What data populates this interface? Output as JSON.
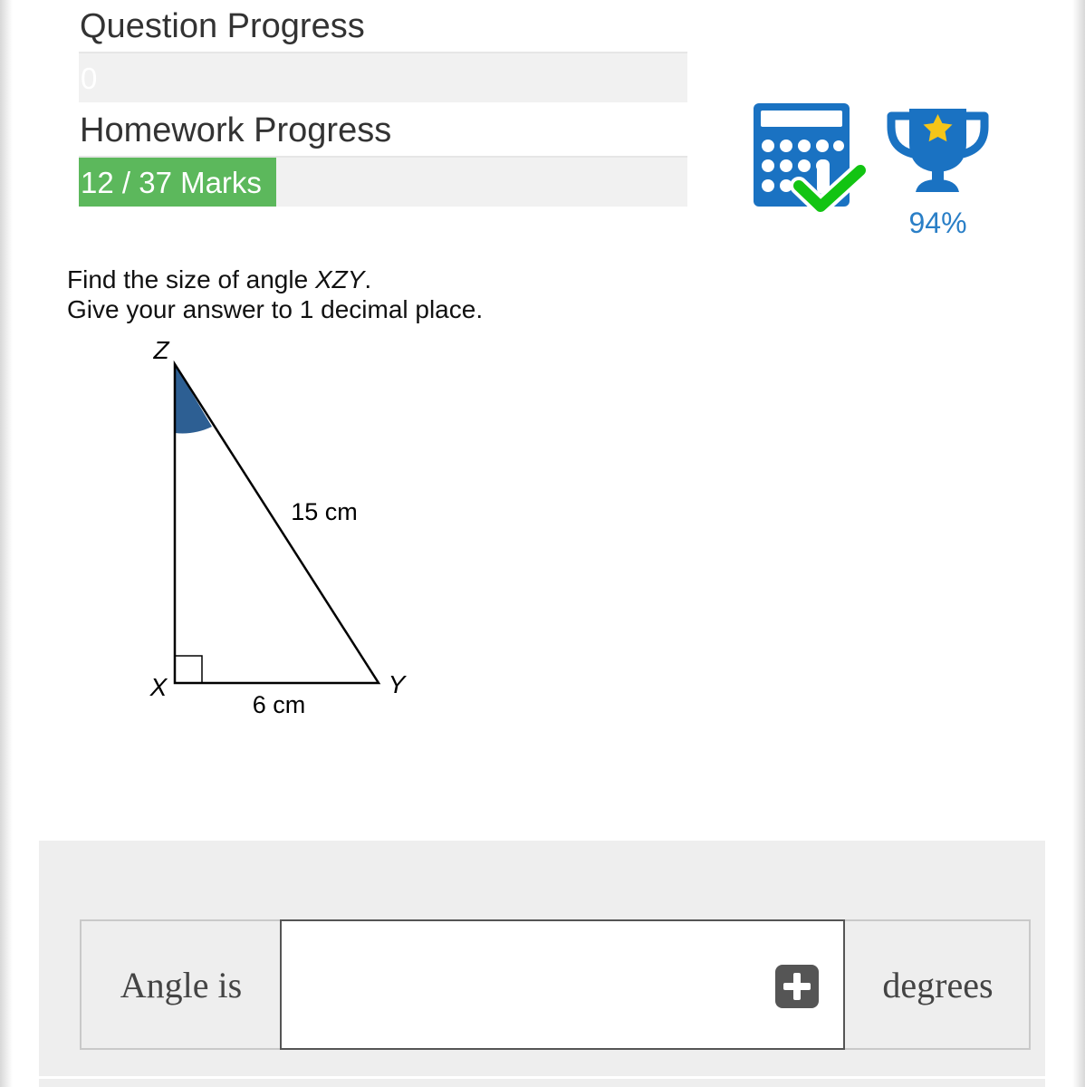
{
  "question_progress": {
    "label": "Question Progress",
    "value_text": "0",
    "fraction": 0
  },
  "homework_progress": {
    "label": "Homework Progress",
    "value_text": "12 / 37 Marks",
    "marks": 12,
    "total": 37
  },
  "icons": {
    "calculator": "calculator-allowed-icon",
    "trophy": "trophy-star-icon"
  },
  "trophy_percent": "94%",
  "colors": {
    "progress_fill": "#5cb85c",
    "icon_blue": "#1a72c2",
    "check_green": "#12c412",
    "angle_fill": "#2d5f93"
  },
  "question": {
    "line1_prefix": "Find the size of angle ",
    "line1_angle": "XZY",
    "line1_suffix": ".",
    "line2": "Give your answer to 1 decimal place."
  },
  "diagram": {
    "vertex_z": "Z",
    "vertex_x": "X",
    "vertex_y": "Y",
    "hypotenuse_label": "15 cm",
    "base_label": "6 cm"
  },
  "answer": {
    "prefix": "Angle is",
    "value": "",
    "suffix": "degrees"
  }
}
